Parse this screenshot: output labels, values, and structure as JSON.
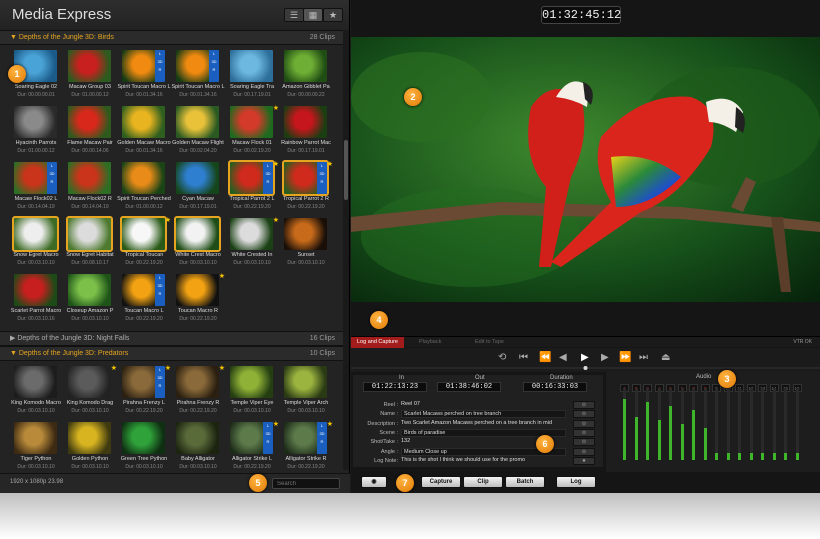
{
  "app": {
    "title": "Media Express"
  },
  "groups": [
    {
      "title": "Depths of the Jungle 3D: Birds",
      "count": "28 Clips",
      "expanded": true,
      "clips": [
        {
          "name": "Soaring Eagle 02",
          "dur": "Dur: 00.00.00.01",
          "c1": "#4aa3d6",
          "c2": "#1b5b8a",
          "three_d": false,
          "star": false,
          "selected": false
        },
        {
          "name": "Macaw Group 03",
          "dur": "Dur: 01.00.00.12",
          "c1": "#c8201e",
          "c2": "#2c5a1f",
          "three_d": false,
          "star": false,
          "selected": false
        },
        {
          "name": "Spirit Toucan Macro L",
          "dur": "Dur: 00.01.34.16",
          "c1": "#f08a10",
          "c2": "#163b14",
          "three_d": true,
          "star": false,
          "selected": false
        },
        {
          "name": "Spirit Toucan Macro L",
          "dur": "Dur: 00.01.34.16",
          "c1": "#f08a10",
          "c2": "#163b14",
          "three_d": true,
          "star": false,
          "selected": false
        },
        {
          "name": "Soaring Eagle Tra",
          "dur": "Dur: 00.17.19.01",
          "c1": "#6cb8e0",
          "c2": "#2d6f9a",
          "three_d": false,
          "star": false,
          "selected": false
        },
        {
          "name": "Amazon Gibblet Pa",
          "dur": "Dur: 00.00.00.22",
          "c1": "#6fae34",
          "c2": "#1f4d14",
          "three_d": false,
          "star": false,
          "selected": false
        },
        {
          "name": "Hyacinth Parrots",
          "dur": "Dur: 01.00.00.12",
          "c1": "#8a8a8a",
          "c2": "#2a2a2a",
          "three_d": false,
          "star": false,
          "selected": false
        },
        {
          "name": "Flame Macaw Pair",
          "dur": "Dur: 00.00.14.06",
          "c1": "#d8281c",
          "c2": "#2e5a1d",
          "three_d": false,
          "star": false,
          "selected": false
        },
        {
          "name": "Golden Macaw Macro",
          "dur": "Dur: 00.01.34.16",
          "c1": "#e8b420",
          "c2": "#2f5f1e",
          "three_d": false,
          "star": false,
          "selected": false
        },
        {
          "name": "Golden Macaw Flight",
          "dur": "Dur: 00.02.04.20",
          "c1": "#e9c23a",
          "c2": "#2a5a22",
          "three_d": false,
          "star": false,
          "selected": false
        },
        {
          "name": "Macaw Flock 01",
          "dur": "Dur: 00.02.19.20",
          "c1": "#d33a2a",
          "c2": "#1e6a1e",
          "three_d": false,
          "star": true,
          "selected": false
        },
        {
          "name": "Rainbow Parrot Mac",
          "dur": "Dur: 00.17.19.01",
          "c1": "#c4161c",
          "c2": "#1b3d12",
          "three_d": false,
          "star": false,
          "selected": false
        },
        {
          "name": "Macaw Flock02 L",
          "dur": "Dur: 00.14.04.19",
          "c1": "#c9341a",
          "c2": "#2d6e24",
          "three_d": true,
          "star": false,
          "selected": false
        },
        {
          "name": "Macaw Flock02 R",
          "dur": "Dur: 00.14.04.19",
          "c1": "#c9341a",
          "c2": "#2d6e24",
          "three_d": false,
          "star": false,
          "selected": false
        },
        {
          "name": "Spirit Toucan Perched",
          "dur": "Dur: 01.00.00.12",
          "c1": "#e98b18",
          "c2": "#1b4416",
          "three_d": false,
          "star": false,
          "selected": false
        },
        {
          "name": "Cyan Macaw",
          "dur": "Dur: 00.17.19.01",
          "c1": "#2e7fd0",
          "c2": "#15451a",
          "three_d": false,
          "star": false,
          "selected": false
        },
        {
          "name": "Tropical Parrot 2 L",
          "dur": "Dur: 00.22.19.20",
          "c1": "#d02a1c",
          "c2": "#275e1f",
          "three_d": true,
          "star": true,
          "selected": true
        },
        {
          "name": "Tropical Parrot 2 R",
          "dur": "Dur: 00.22.19.20",
          "c1": "#d02a1c",
          "c2": "#275e1f",
          "three_d": true,
          "star": true,
          "selected": true
        },
        {
          "name": "Snow Egret Macro",
          "dur": "Dur: 00.03.10.10",
          "c1": "#eeeeee",
          "c2": "#3d6b25",
          "three_d": false,
          "star": false,
          "selected": true
        },
        {
          "name": "Snow Egret Habitat",
          "dur": "Dur: 00.08.10.17",
          "c1": "#dcdcdc",
          "c2": "#4d7a2e",
          "three_d": false,
          "star": false,
          "selected": true
        },
        {
          "name": "Tropical Toucan",
          "dur": "Dur: 00.22.19.20",
          "c1": "#f7f7f7",
          "c2": "#2a5a18",
          "three_d": false,
          "star": true,
          "selected": true
        },
        {
          "name": "White Crest Macro",
          "dur": "Dur: 00.03.10.10",
          "c1": "#f2f2f2",
          "c2": "#1f4d17",
          "three_d": false,
          "star": false,
          "selected": true
        },
        {
          "name": "White Crested In",
          "dur": "Dur: 00.03.10.10",
          "c1": "#dcdcdc",
          "c2": "#1b4015",
          "three_d": false,
          "star": true,
          "selected": false
        },
        {
          "name": "Sunset",
          "dur": "Dur: 00.03.10.10",
          "c1": "#c76a1a",
          "c2": "#1a0f08",
          "three_d": false,
          "star": false,
          "selected": false
        },
        {
          "name": "Scarlet Parrot Macro",
          "dur": "Dur: 00.03.10.16",
          "c1": "#c71f1f",
          "c2": "#1d4a17",
          "three_d": false,
          "star": false,
          "selected": false
        },
        {
          "name": "Closeup Amazon P",
          "dur": "Dur: 00.03.10.10",
          "c1": "#7cc04a",
          "c2": "#1e5418",
          "three_d": false,
          "star": false,
          "selected": false
        },
        {
          "name": "Toucan Macro L",
          "dur": "Dur: 00.22.19.20",
          "c1": "#f2a212",
          "c2": "#111111",
          "three_d": true,
          "star": false,
          "selected": false
        },
        {
          "name": "Toucan Macro R",
          "dur": "Dur: 00.22.19.20",
          "c1": "#f2a212",
          "c2": "#111111",
          "three_d": false,
          "star": true,
          "selected": false
        }
      ]
    },
    {
      "title": "Depths of the Jungle 3D: Night Falls",
      "count": "16 Clips",
      "expanded": false,
      "clips": []
    },
    {
      "title": "Depths of the Jungle 3D: Predators",
      "count": "10 Clips",
      "expanded": true,
      "clips": [
        {
          "name": "King Komodo Macro",
          "dur": "Dur: 00.03.10.10",
          "c1": "#6b6b6b",
          "c2": "#1c1c1c",
          "three_d": false,
          "star": false,
          "selected": false
        },
        {
          "name": "King Komodo Drag",
          "dur": "Dur: 00.03.10.10",
          "c1": "#5b5b5b",
          "c2": "#222222",
          "three_d": false,
          "star": true,
          "selected": false
        },
        {
          "name": "Pirahna Frenzy L",
          "dur": "Dur: 00.22.19.20",
          "c1": "#8a6a3a",
          "c2": "#2a1f10",
          "three_d": true,
          "star": true,
          "selected": false
        },
        {
          "name": "Pirahna Frenzy R",
          "dur": "Dur: 00.22.19.20",
          "c1": "#8a6a3a",
          "c2": "#2a1f10",
          "three_d": false,
          "star": true,
          "selected": false
        },
        {
          "name": "Temple Viper Eye",
          "dur": "Dur: 00.03.10.10",
          "c1": "#8fb136",
          "c2": "#243e12",
          "three_d": false,
          "star": false,
          "selected": false
        },
        {
          "name": "Temple Viper Arch",
          "dur": "Dur: 00.03.10.10",
          "c1": "#9bb33f",
          "c2": "#2a3a14",
          "three_d": false,
          "star": false,
          "selected": false
        },
        {
          "name": "Tiger Python",
          "dur": "Dur: 00.03.10.10",
          "c1": "#b88a3a",
          "c2": "#3d2a12",
          "three_d": false,
          "star": false,
          "selected": false
        },
        {
          "name": "Golden Python",
          "dur": "Dur: 00.03.10.10",
          "c1": "#d8b520",
          "c2": "#3f3a10",
          "three_d": false,
          "star": false,
          "selected": false
        },
        {
          "name": "Green Tree Python",
          "dur": "Dur: 00.03.10.10",
          "c1": "#2fa33a",
          "c2": "#0f2f12",
          "three_d": false,
          "star": false,
          "selected": false
        },
        {
          "name": "Baby Alligator",
          "dur": "Dur: 00.03.10.10",
          "c1": "#5a6b3a",
          "c2": "#1c2410",
          "three_d": false,
          "star": false,
          "selected": false
        },
        {
          "name": "Alligator Strike L",
          "dur": "Dur: 00.22.19.20",
          "c1": "#5c7a4a",
          "c2": "#1c2a18",
          "three_d": true,
          "star": true,
          "selected": false
        },
        {
          "name": "Alligator Strike R",
          "dur": "Dur: 00.22.19.20",
          "c1": "#5c7a4a",
          "c2": "#1c2a18",
          "three_d": true,
          "star": true,
          "selected": false
        }
      ]
    }
  ],
  "status": {
    "resolution": "1920 x 1080p 23.98",
    "search_placeholder": "Search"
  },
  "timecode": {
    "current": "01:32:45:12"
  },
  "tabs": [
    "Log and Capture",
    "Playback",
    "Edit to Tape"
  ],
  "vtr_status": "VTR OK",
  "capture": {
    "in_label": "In",
    "in": "01:22:13:23",
    "out_label": "Out",
    "out": "01:38:46:02",
    "dur_label": "Duration",
    "dur": "00:16:33:03"
  },
  "fields": [
    {
      "label": "Reel :",
      "value": "Reel 07"
    },
    {
      "label": "Name :",
      "value": "Scarlet Macaws perched on tree branch"
    },
    {
      "label": "Description :",
      "value": "Two Scarlet Amazon Macaws perched on a tree branch in mid"
    },
    {
      "label": "Scene :",
      "value": "Birds of paradise"
    },
    {
      "label": "Shot/Take :",
      "value": "132"
    },
    {
      "label": "Angle :",
      "value": "Medium Close up"
    },
    {
      "label": "Log Note:",
      "value": "This is the shot I think we should use for the promo"
    }
  ],
  "buttons": {
    "capture": "Capture",
    "clip": "Clip",
    "batch": "Batch",
    "log": "Log"
  },
  "audio": {
    "label": "Audio",
    "channels": [
      "1",
      "2",
      "3",
      "4",
      "5",
      "6",
      "7",
      "8",
      "9",
      "10",
      "11",
      "12",
      "13",
      "14",
      "15",
      "16"
    ],
    "enabled": 8,
    "levels": [
      0.85,
      0.6,
      0.8,
      0.55,
      0.75,
      0.5,
      0.7,
      0.45,
      0.1,
      0.1,
      0.1,
      0.1,
      0.1,
      0.1,
      0.1,
      0.1
    ]
  },
  "playback": {
    "progress": 0.5
  },
  "markers": [
    "1",
    "2",
    "3",
    "4",
    "5",
    "6",
    "7"
  ],
  "colors": {
    "accent": "#e6a520",
    "tab_active": "#a21c1c",
    "meter": "#3fb52b",
    "marker": "#f09210"
  }
}
